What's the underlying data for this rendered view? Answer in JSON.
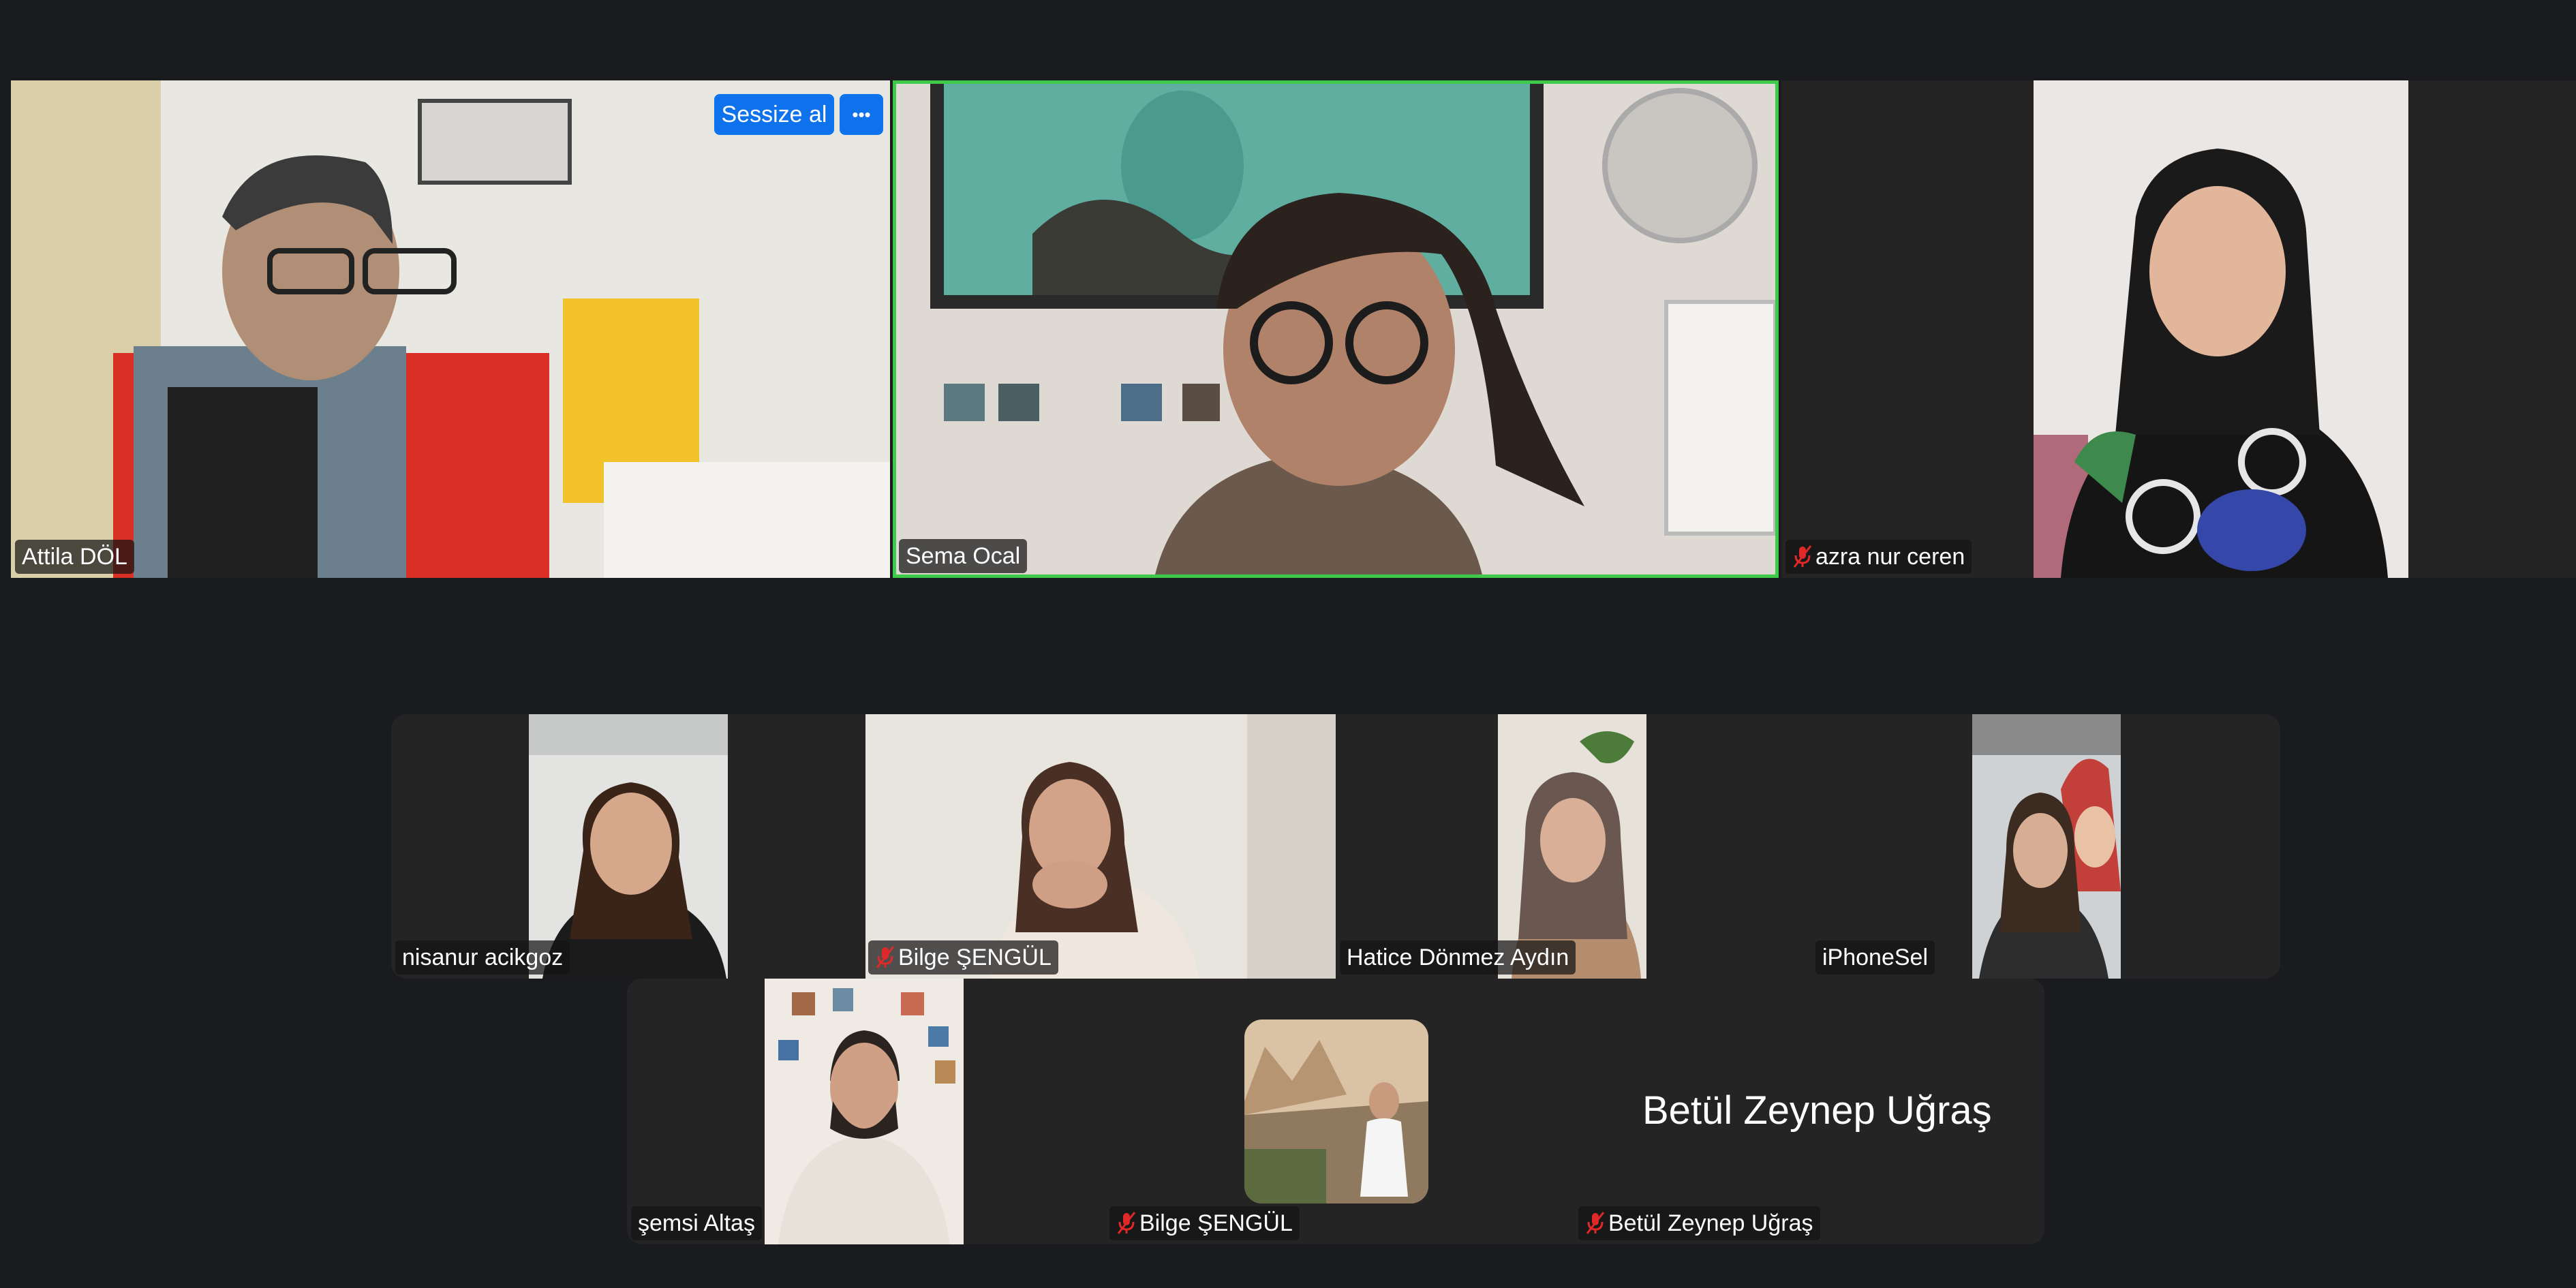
{
  "window": {
    "background": "#1a1b1f",
    "tile_background": "#242424",
    "active_speaker_color": "#3ec94b",
    "button_color": "#0e72ed"
  },
  "top_row": [
    {
      "id": "attila",
      "name": "Attila DÖL",
      "muted": false,
      "has_video": true,
      "buttons": {
        "mute_label": "Sessize al",
        "more_label": "•••"
      }
    },
    {
      "id": "sema",
      "name": "Sema Ocal",
      "muted": false,
      "has_video": true,
      "active_speaker": true
    },
    {
      "id": "azra",
      "name": "azra nur ceren",
      "muted": true,
      "has_video": true
    }
  ],
  "middle_row": [
    {
      "id": "nisanur",
      "name": "nisanur acikgoz",
      "muted": false,
      "has_video": true
    },
    {
      "id": "bilge1",
      "name": "Bilge ŞENGÜL",
      "muted": true,
      "has_video": true
    },
    {
      "id": "hatice",
      "name": "Hatice Dönmez Aydın",
      "muted": false,
      "has_video": true
    },
    {
      "id": "iphonesel",
      "name": "iPhoneSel",
      "muted": false,
      "has_video": true
    }
  ],
  "bottom_row": [
    {
      "id": "semsi",
      "name": "şemsi Altaş",
      "muted": false,
      "has_video": true
    },
    {
      "id": "bilge2",
      "name": "Bilge ŞENGÜL",
      "muted": true,
      "has_video": false,
      "avatar": "photo-avatar"
    },
    {
      "id": "betul",
      "name": "Betül Zeynep Uğraş",
      "display_name": "Betül Zeynep Uğraş",
      "muted": true,
      "has_video": false
    }
  ]
}
